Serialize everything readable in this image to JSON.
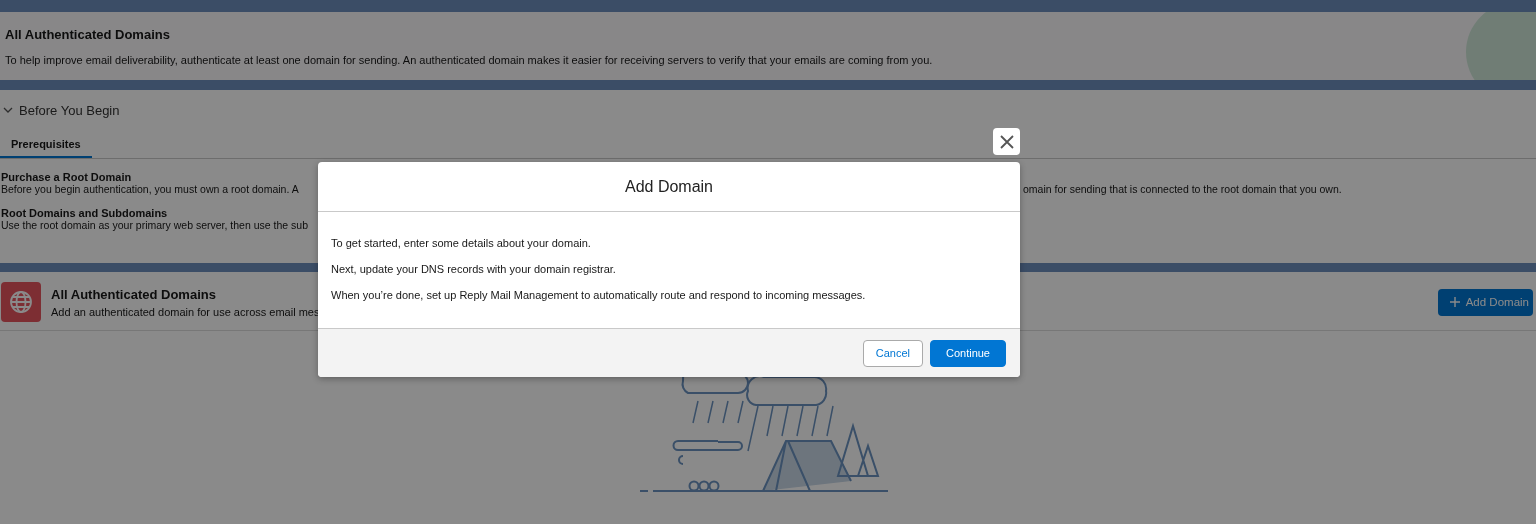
{
  "header": {
    "title": "All Authenticated Domains",
    "description": "To help improve email deliverability, authenticate at least one domain for sending. An authenticated domain makes it easier for receiving servers to verify that your emails are coming from you."
  },
  "before_you_begin": {
    "title": "Before You Begin",
    "expanded": true,
    "tabs": [
      {
        "label": "Prerequisites",
        "selected": true
      }
    ],
    "sections": [
      {
        "title": "Purchase a Root Domain",
        "text_left": "Before you begin authentication, you must own a root domain. A",
        "text_right": "omain for sending that is connected to the root domain that you own."
      },
      {
        "title": "Root Domains and Subdomains",
        "text_left": "Use the root domain as your primary web server, then use the sub"
      }
    ]
  },
  "domains": {
    "title": "All Authenticated Domains",
    "description": "Add an authenticated domain for use across email mes",
    "add_button": "Add Domain"
  },
  "modal": {
    "title": "Add Domain",
    "paragraphs": [
      "To get started, enter some details about your domain.",
      "Next, update your DNS records with your domain registrar.",
      "When you’re done, set up Reply Mail Management to automatically route and respond to incoming messages."
    ],
    "cancel": "Cancel",
    "continue": "Continue"
  }
}
